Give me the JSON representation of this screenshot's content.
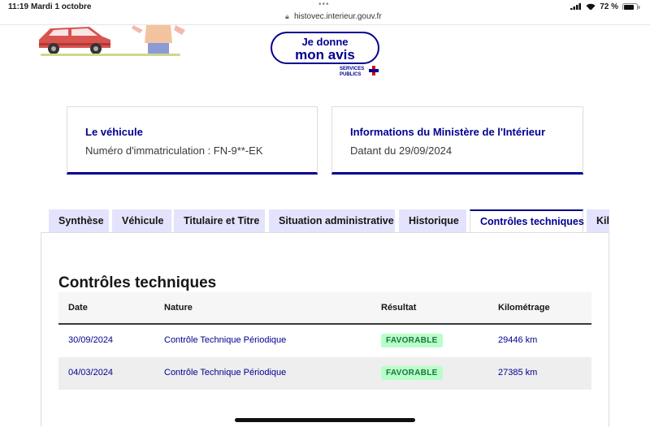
{
  "status_bar": {
    "time": "11:19",
    "date": "Mardi 1 octobre",
    "url": "histovec.interieur.gouv.fr",
    "battery": "72 %"
  },
  "header": {
    "avis_line1": "Je donne",
    "avis_line2": "mon avis",
    "services_line1": "SERVICES",
    "services_line2": "PUBLICS"
  },
  "cards": [
    {
      "title": "Le véhicule",
      "subtitle": "Numéro d'immatriculation : FN-9**-EK"
    },
    {
      "title": "Informations du Ministère de l'Intérieur",
      "subtitle": "Datant du 29/09/2024"
    }
  ],
  "tabs": [
    {
      "label": "Synthèse"
    },
    {
      "label": "Véhicule"
    },
    {
      "label": "Titulaire et Titre"
    },
    {
      "label": "Situation administrative"
    },
    {
      "label": "Historique"
    },
    {
      "label": "Contrôles techniques",
      "active": true
    },
    {
      "label": "Kilométrage"
    }
  ],
  "section": {
    "title": "Contrôles techniques",
    "columns": [
      "Date",
      "Nature",
      "Résultat",
      "Kilométrage"
    ],
    "rows": [
      {
        "date": "30/09/2024",
        "nature": "Contrôle Technique Périodique",
        "result": "FAVORABLE",
        "km": "29446 km"
      },
      {
        "date": "04/03/2024",
        "nature": "Contrôle Technique Périodique",
        "result": "FAVORABLE",
        "km": "27385 km"
      }
    ]
  },
  "colors": {
    "primary": "#000091",
    "tab_bg": "#e3e3fd",
    "badge_bg": "#b8fec9",
    "badge_text": "#18753c"
  }
}
